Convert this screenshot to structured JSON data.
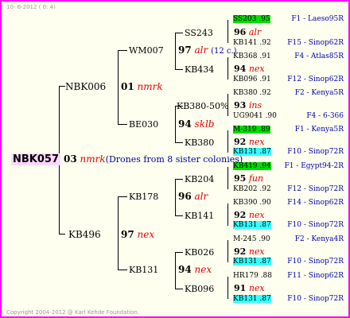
{
  "header": "10-  6-2012 (  0: 4)",
  "footer": "Copyright 2004-2012 @ Karl Kehde Foundation.",
  "root": {
    "id": "NBK057",
    "num": "03",
    "mark": "nmrk",
    "comment": "(Drones from 8 sister colonies)"
  },
  "g1": [
    {
      "id": "NBK006",
      "num": "01",
      "mark": "nmrk"
    },
    {
      "id": "KB496",
      "num": "97",
      "mark": "nex"
    }
  ],
  "g2": [
    {
      "id": "WM007",
      "num": "97",
      "mark": "alr",
      "comment": "(12 c.)"
    },
    {
      "id": "BE030",
      "num": "94",
      "mark": "sklb"
    },
    {
      "id": "KB178",
      "num": "96",
      "mark": "alr"
    },
    {
      "id": "KB131",
      "num": "94",
      "mark": "nex"
    }
  ],
  "g3": [
    {
      "id": "SS243",
      "num": "96",
      "mark": "alr"
    },
    {
      "id": "KB434",
      "num": "94",
      "mark": "nex"
    },
    {
      "id": "KB380-50%",
      "num": "93",
      "mark": "ins"
    },
    {
      "id": "KB380",
      "num": "92",
      "mark": "nex"
    },
    {
      "id": "KB204",
      "num": "95",
      "mark": "fun"
    },
    {
      "id": "KB141",
      "num": "92",
      "mark": "nex"
    },
    {
      "id": "KB026",
      "num": "92",
      "mark": "nex"
    },
    {
      "id": "KB096",
      "num": "91",
      "mark": "nex"
    }
  ],
  "g4": [
    {
      "id": "SS203 .95",
      "right": "F1 - Laeso95R"
    },
    {
      "id": "KB141 .92",
      "right": "F15 - Sinop62R"
    },
    {
      "id": "KB368 .91",
      "right": "F4 - Atlas85R"
    },
    {
      "id": "KB096 .91",
      "right": "F12 - Sinop62R"
    },
    {
      "id": "KB380 .92",
      "right": "F2 - Kenya5R"
    },
    {
      "id": "UG9041 .90",
      "right": "F4 - 6-366"
    },
    {
      "id": "M-319 .89",
      "right": "F1 - Kenya5R"
    },
    {
      "id": "KB131 .87",
      "right": "F10 - Sinop72R"
    },
    {
      "id": "KB419 .94",
      "right": "F1 - Egypt94-2R"
    },
    {
      "id": "KB202 .92",
      "right": "F12 - Sinop72R"
    },
    {
      "id": "KB390 .90",
      "right": "F14 - Sinop62R"
    },
    {
      "id": "KB131 .87",
      "right": "F10 - Sinop72R"
    },
    {
      "id": "M-245 .90",
      "right": "F2 - Kenya4R"
    },
    {
      "id": "KB131 .87",
      "right": "F10 - Sinop72R"
    },
    {
      "id": "HR179 .88",
      "right": "F11 - Sinop62R"
    },
    {
      "id": "KB131 .87",
      "right": "F10 - Sinop72R"
    }
  ],
  "colors": {
    "frame": "#ff00ff",
    "root_bg": "#ffd6ff",
    "green": "#00dc00",
    "cyan": "#33ffff",
    "mark": "#e00000",
    "link": "#0000a8"
  }
}
